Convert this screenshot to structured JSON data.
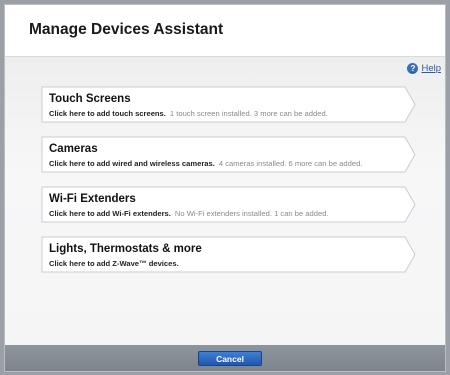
{
  "dialog": {
    "title": "Manage Devices Assistant",
    "help_label": "Help",
    "help_icon": "question-icon",
    "cancel_label": "Cancel"
  },
  "cards": [
    {
      "title": "Touch Screens",
      "action": "Click here to add touch screens.",
      "status": "1 touch screen installed. 3 more can be added."
    },
    {
      "title": "Cameras",
      "action": "Click here to add wired and wireless cameras.",
      "status": "4 cameras installed. 6 more can be added."
    },
    {
      "title": "Wi-Fi Extenders",
      "action": "Click here to add Wi-Fi extenders.",
      "status": "No Wi-Fi extenders installed. 1 can be added."
    },
    {
      "title": "Lights, Thermostats & more",
      "action": "Click here to add Z-Wave™ devices.",
      "status": ""
    }
  ],
  "colors": {
    "accent": "#2a5aa8",
    "button": "#1f57ac"
  }
}
